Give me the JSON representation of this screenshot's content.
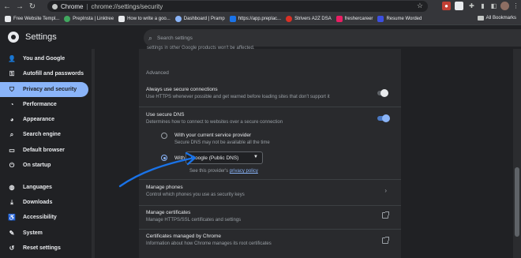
{
  "address_bar": {
    "site_label": "Chrome",
    "url": "chrome://settings/security"
  },
  "bookmarks": [
    {
      "label": "Free Website Templ...",
      "color": "#e8eaed"
    },
    {
      "label": "PrepInsta | Linktree",
      "color": "#41a85f"
    },
    {
      "label": "How to write a goo...",
      "color": "#ffffff"
    },
    {
      "label": "Dashboard | Pramp",
      "color": "#8ab4f8"
    },
    {
      "label": "https://app.preplac...",
      "color": "#1a73e8"
    },
    {
      "label": "Strivers A2Z DSA",
      "color": "#d93025"
    },
    {
      "label": "freshercareer",
      "color": "#e8eaed"
    },
    {
      "label": "Resume Worded",
      "color": "#3c4fe0"
    }
  ],
  "bookmarks_all": "All Bookmarks",
  "header": {
    "title": "Settings",
    "search_placeholder": "Search settings"
  },
  "sidebar": {
    "items": [
      {
        "label": "You and Google",
        "icon": "google-icon"
      },
      {
        "label": "Autofill and passwords",
        "icon": "key-icon"
      },
      {
        "label": "Privacy and security",
        "icon": "shield-icon",
        "active": true
      },
      {
        "label": "Performance",
        "icon": "speedometer-icon"
      },
      {
        "label": "Appearance",
        "icon": "palette-icon"
      },
      {
        "label": "Search engine",
        "icon": "search-icon"
      },
      {
        "label": "Default browser",
        "icon": "browser-icon"
      },
      {
        "label": "On startup",
        "icon": "power-icon"
      },
      {
        "label": "Languages",
        "icon": "globe-icon"
      },
      {
        "label": "Downloads",
        "icon": "download-icon"
      },
      {
        "label": "Accessibility",
        "icon": "accessibility-icon"
      },
      {
        "label": "System",
        "icon": "wrench-icon"
      },
      {
        "label": "Reset settings",
        "icon": "reset-icon"
      }
    ]
  },
  "main": {
    "top_cut_text": "settings in other Google products won't be affected.",
    "advanced_label": "Advanced",
    "secure_connections": {
      "title": "Always use secure connections",
      "subtitle": "Use HTTPS whenever possible and get warned before loading sites that don't support it",
      "enabled": false
    },
    "secure_dns": {
      "title": "Use secure DNS",
      "subtitle": "Determines how to connect to websites over a secure connection",
      "enabled": true,
      "option_current_title": "With your current service provider",
      "option_current_sub": "Secure DNS may not be available all the time",
      "option_with_label": "With",
      "provider_selected": "Google (Public DNS)",
      "provider_note_prefix": "See this provider's",
      "provider_note_link": "privacy policy"
    },
    "manage_phones": {
      "title": "Manage phones",
      "subtitle": "Control which phones you use as security keys"
    },
    "manage_certificates": {
      "title": "Manage certificates",
      "subtitle": "Manage HTTPS/SSL certificates and settings"
    },
    "certs_by_chrome": {
      "title": "Certificates managed by Chrome",
      "subtitle": "Information about how Chrome manages its root certificates"
    }
  },
  "colors": {
    "accent": "#8ab4f8",
    "annotation_arrow": "#1a73e8"
  }
}
